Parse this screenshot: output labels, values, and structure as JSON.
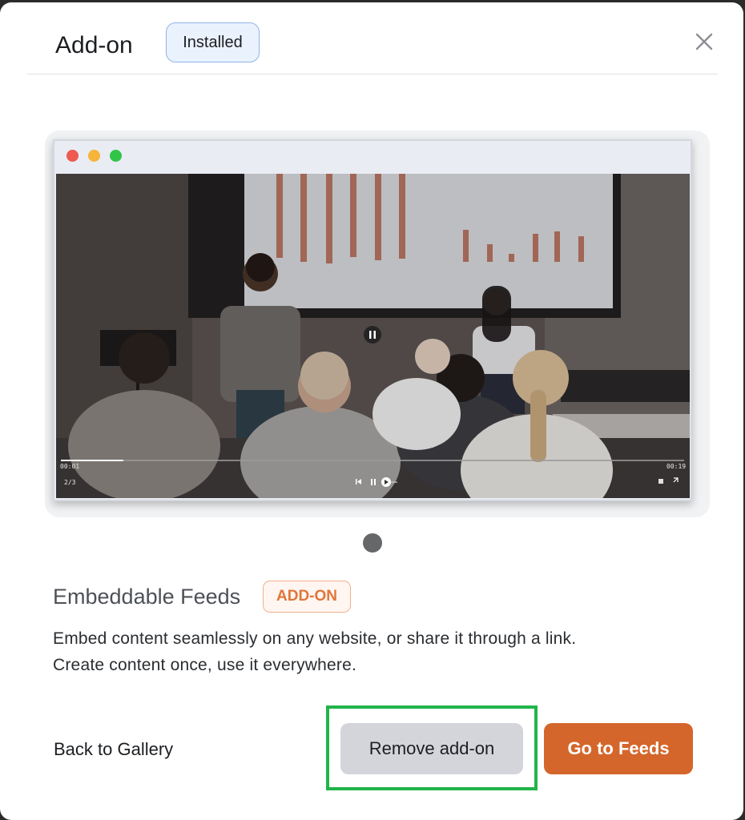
{
  "modal": {
    "title": "Add-on",
    "status_badge": "Installed",
    "close_icon": "close-icon"
  },
  "preview": {
    "window_dots": [
      "#ee5a4f",
      "#f6b43a",
      "#31c548"
    ],
    "video": {
      "time_elapsed": "00:01",
      "time_total": "00:19",
      "slide_counter": "2/3",
      "progress": 0.1
    },
    "carousel": {
      "current": 1,
      "total": 1
    }
  },
  "addon": {
    "name": "Embeddable Feeds",
    "badge": "ADD-ON",
    "description": "Embed content seamlessly on any website, or share it through a link. Create content once, use it everywhere."
  },
  "actions": {
    "back_label": "Back to Gallery",
    "remove_label": "Remove add-on",
    "primary_label": "Go to Feeds"
  },
  "colors": {
    "accent": "#d4662b",
    "highlight": "#21b44a",
    "installed_border": "#8eb3e8"
  }
}
